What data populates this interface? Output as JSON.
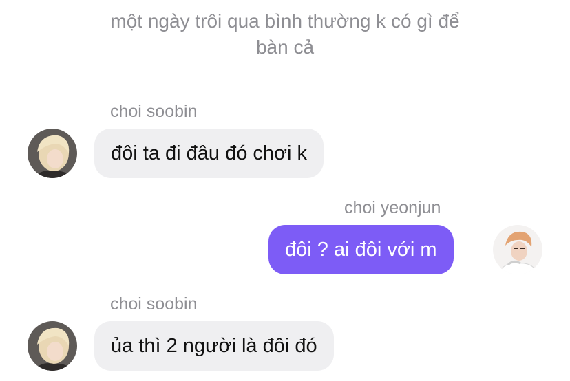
{
  "system_note": {
    "line1": "một ngày trôi qua bình thường k có gì để",
    "line2": "bàn cả"
  },
  "messages": [
    {
      "sender": "choi soobin",
      "text": "đôi ta đi đâu đó chơi k",
      "direction": "incoming",
      "avatar_icon": "avatar-soobin"
    },
    {
      "sender": "choi yeonjun",
      "text": "đôi ? ai đôi với m",
      "direction": "outgoing",
      "avatar_icon": "avatar-yeonjun"
    },
    {
      "sender": "choi soobin",
      "text": "ủa thì 2 người là đôi đó",
      "direction": "incoming",
      "avatar_icon": "avatar-soobin"
    }
  ],
  "colors": {
    "incoming_bubble": "#efeff1",
    "outgoing_bubble": "#7d5cf6",
    "meta_text": "#8e8e93"
  }
}
